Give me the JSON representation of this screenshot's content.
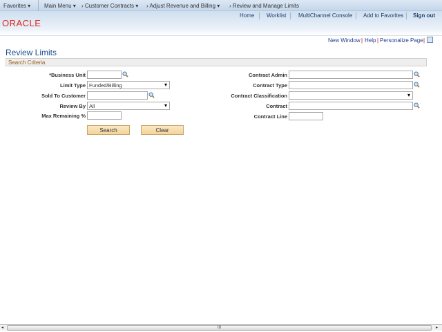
{
  "nav": {
    "favorites": "Favorites",
    "main_menu": "Main Menu",
    "crumbs": [
      "Customer Contracts",
      "Adjust Revenue and Billing",
      "Review and Manage Limits"
    ]
  },
  "header": {
    "logo": "ORACLE",
    "links": [
      "Home",
      "Worklist",
      "MultiChannel Console",
      "Add to Favorites"
    ],
    "sign_out": "Sign out"
  },
  "toolbar": {
    "new_window": "New Window",
    "help": "Help",
    "personalize": "Personalize Page"
  },
  "page": {
    "title": "Review Limits",
    "section": "Search Criteria"
  },
  "form": {
    "business_unit": {
      "label": "*Business Unit",
      "value": ""
    },
    "limit_type": {
      "label": "Limit Type",
      "value": "Funded/Billing"
    },
    "sold_to": {
      "label": "Sold To Customer",
      "value": ""
    },
    "review_by": {
      "label": "Review By",
      "value": "All"
    },
    "max_remaining": {
      "label": "Max Remaining %",
      "value": ""
    },
    "contract_admin": {
      "label": "Contract Admin",
      "value": ""
    },
    "contract_type": {
      "label": "Contract Type",
      "value": ""
    },
    "contract_class": {
      "label": "Contract Classification",
      "value": ""
    },
    "contract": {
      "label": "Contract",
      "value": ""
    },
    "contract_line": {
      "label": "Contract Line",
      "value": ""
    }
  },
  "buttons": {
    "search": "Search",
    "clear": "Clear"
  },
  "scrollbar": {
    "grip": "III"
  }
}
